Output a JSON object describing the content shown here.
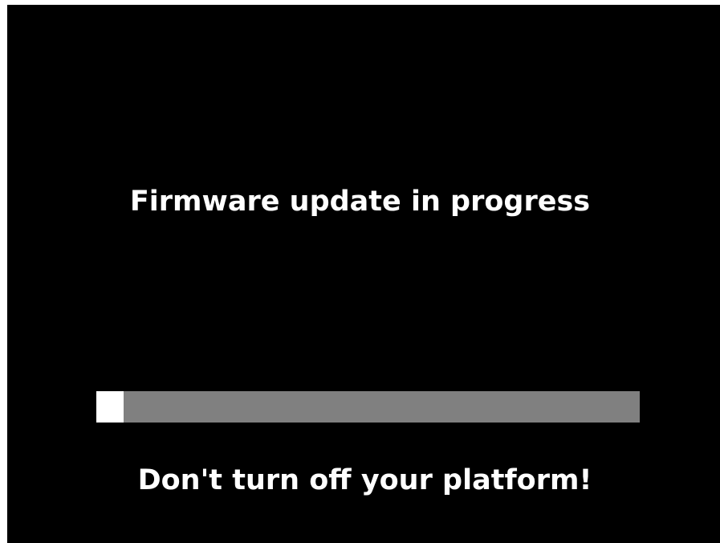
{
  "title": "Firmware update in progress",
  "warning": "Don't turn off your platform!",
  "progress": {
    "value": 0.05,
    "fill_color": "#ffffff",
    "track_color": "#808080"
  },
  "colors": {
    "background": "#000000",
    "text": "#ffffff"
  }
}
